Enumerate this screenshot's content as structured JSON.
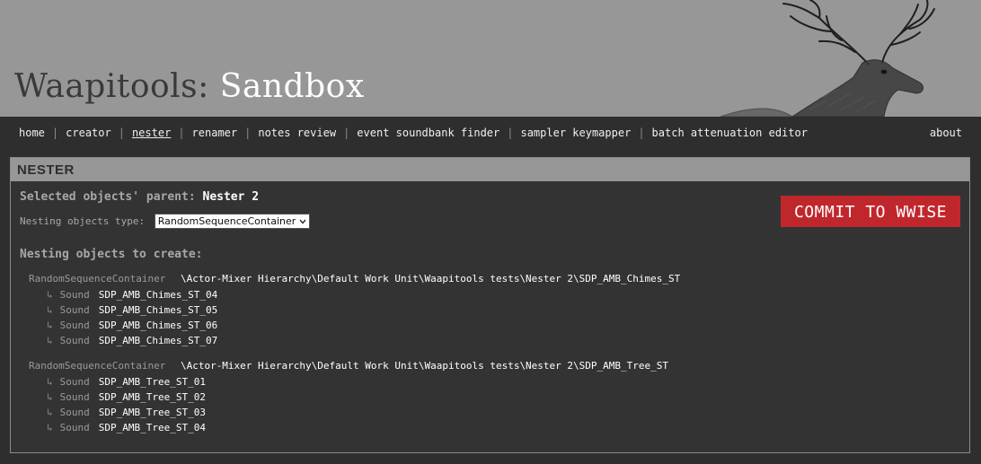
{
  "header": {
    "title_prefix": "Waapitools:",
    "title_suffix": "Sandbox"
  },
  "nav": {
    "items": [
      "home",
      "creator",
      "nester",
      "renamer",
      "notes review",
      "event soundbank finder",
      "sampler keymapper",
      "batch attenuation editor"
    ],
    "active": "nester",
    "separator": "|",
    "about": "about"
  },
  "panel": {
    "heading": "NESTER",
    "parent_label": "Selected objects' parent:",
    "parent_value": "Nester 2",
    "type_label": "Nesting objects type:",
    "type_value": "RandomSequenceContainer",
    "commit_label": "COMMIT TO WWISE",
    "to_create_label": "Nesting objects to create:",
    "groups": [
      {
        "type": "RandomSequenceContainer",
        "path": "\\Actor-Mixer Hierarchy\\Default Work Unit\\Waapitools tests\\Nester 2\\SDP_AMB_Chimes_ST",
        "children": [
          {
            "arrow": "↳",
            "type": "Sound",
            "name": "SDP_AMB_Chimes_ST_04"
          },
          {
            "arrow": "↳",
            "type": "Sound",
            "name": "SDP_AMB_Chimes_ST_05"
          },
          {
            "arrow": "↳",
            "type": "Sound",
            "name": "SDP_AMB_Chimes_ST_06"
          },
          {
            "arrow": "↳",
            "type": "Sound",
            "name": "SDP_AMB_Chimes_ST_07"
          }
        ]
      },
      {
        "type": "RandomSequenceContainer",
        "path": "\\Actor-Mixer Hierarchy\\Default Work Unit\\Waapitools tests\\Nester 2\\SDP_AMB_Tree_ST",
        "children": [
          {
            "arrow": "↳",
            "type": "Sound",
            "name": "SDP_AMB_Tree_ST_01"
          },
          {
            "arrow": "↳",
            "type": "Sound",
            "name": "SDP_AMB_Tree_ST_02"
          },
          {
            "arrow": "↳",
            "type": "Sound",
            "name": "SDP_AMB_Tree_ST_03"
          },
          {
            "arrow": "↳",
            "type": "Sound",
            "name": "SDP_AMB_Tree_ST_04"
          }
        ]
      }
    ]
  },
  "colors": {
    "header_bg": "#979797",
    "page_bg": "#2e2e2e",
    "accent_red": "#c0272d"
  },
  "icons": {
    "header_art": "elk-illustration",
    "dropdown": "chevron-down-icon",
    "child_arrow": "child-arrow-icon"
  }
}
